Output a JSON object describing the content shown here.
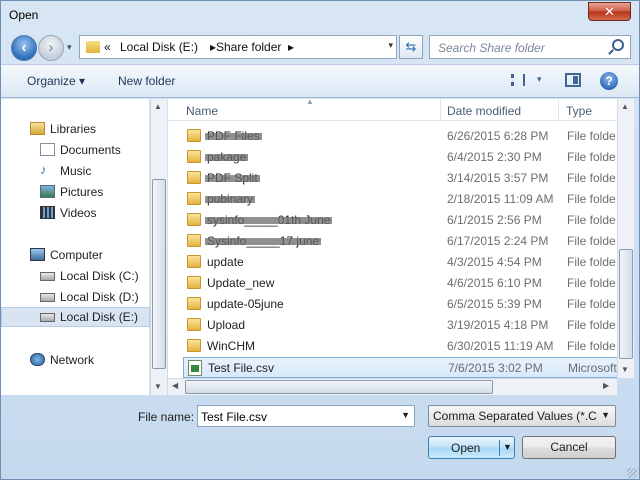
{
  "window": {
    "title": "Open",
    "close_label": "✕"
  },
  "address": {
    "recent_icon": "chevron-double-left",
    "crumbs": [
      "Local Disk (E:)",
      "Share folder"
    ],
    "separator": "▸",
    "dropdown_glyph": "▾",
    "refresh_glyph": "⇆"
  },
  "search": {
    "placeholder": "Search Share folder"
  },
  "toolbar": {
    "organize_label": "Organize ▾",
    "new_folder_label": "New folder",
    "view_dropdown": "▾",
    "help_label": "?"
  },
  "nav": {
    "items": [
      {
        "label": "Libraries",
        "icon": "libraries-icon"
      },
      {
        "label": "Documents",
        "icon": "documents-icon"
      },
      {
        "label": "Music",
        "icon": "music-icon"
      },
      {
        "label": "Pictures",
        "icon": "pictures-icon"
      },
      {
        "label": "Videos",
        "icon": "videos-icon"
      },
      {
        "label": "Computer",
        "icon": "computer-icon"
      },
      {
        "label": "Local Disk (C:)",
        "icon": "drive-icon"
      },
      {
        "label": "Local Disk (D:)",
        "icon": "drive-icon"
      },
      {
        "label": "Local Disk (E:)",
        "icon": "drive-icon",
        "selected": true
      },
      {
        "label": "Network",
        "icon": "network-icon"
      }
    ]
  },
  "columns": {
    "name": "Name",
    "date": "Date modified",
    "type": "Type"
  },
  "files": [
    {
      "name": "PDF Files",
      "date": "6/26/2015 6:28 PM",
      "type": "File folde",
      "redacted": true
    },
    {
      "name": "pakage",
      "date": "6/4/2015 2:30 PM",
      "type": "File folde",
      "redacted": true
    },
    {
      "name": "PDF Split",
      "date": "3/14/2015 3:57 PM",
      "type": "File folde",
      "redacted": true
    },
    {
      "name": "pubinary",
      "date": "2/18/2015 11:09 AM",
      "type": "File folde",
      "redacted": true
    },
    {
      "name": "sysinfo_____01th June",
      "date": "6/1/2015 2:56 PM",
      "type": "File folde",
      "redacted": true
    },
    {
      "name": "Sysinfo_____17 june",
      "date": "6/17/2015 2:24 PM",
      "type": "File folde",
      "redacted": true
    },
    {
      "name": "update",
      "date": "4/3/2015 4:54 PM",
      "type": "File folde"
    },
    {
      "name": "Update_new",
      "date": "4/6/2015 6:10 PM",
      "type": "File folde"
    },
    {
      "name": "update-05june",
      "date": "6/5/2015 5:39 PM",
      "type": "File folde"
    },
    {
      "name": "Upload",
      "date": "3/19/2015 4:18 PM",
      "type": "File folde"
    },
    {
      "name": "WinCHM",
      "date": "6/30/2015 11:19 AM",
      "type": "File folde"
    },
    {
      "name": "Test File.csv",
      "date": "7/6/2015 3:02 PM",
      "type": "Microsoft",
      "selected": true,
      "csv": true
    }
  ],
  "bottom": {
    "file_name_label": "File name:",
    "file_name_value": "Test File.csv",
    "filter_value": "Comma Separated Values (*.CS",
    "open_label": "Open",
    "cancel_label": "Cancel"
  }
}
